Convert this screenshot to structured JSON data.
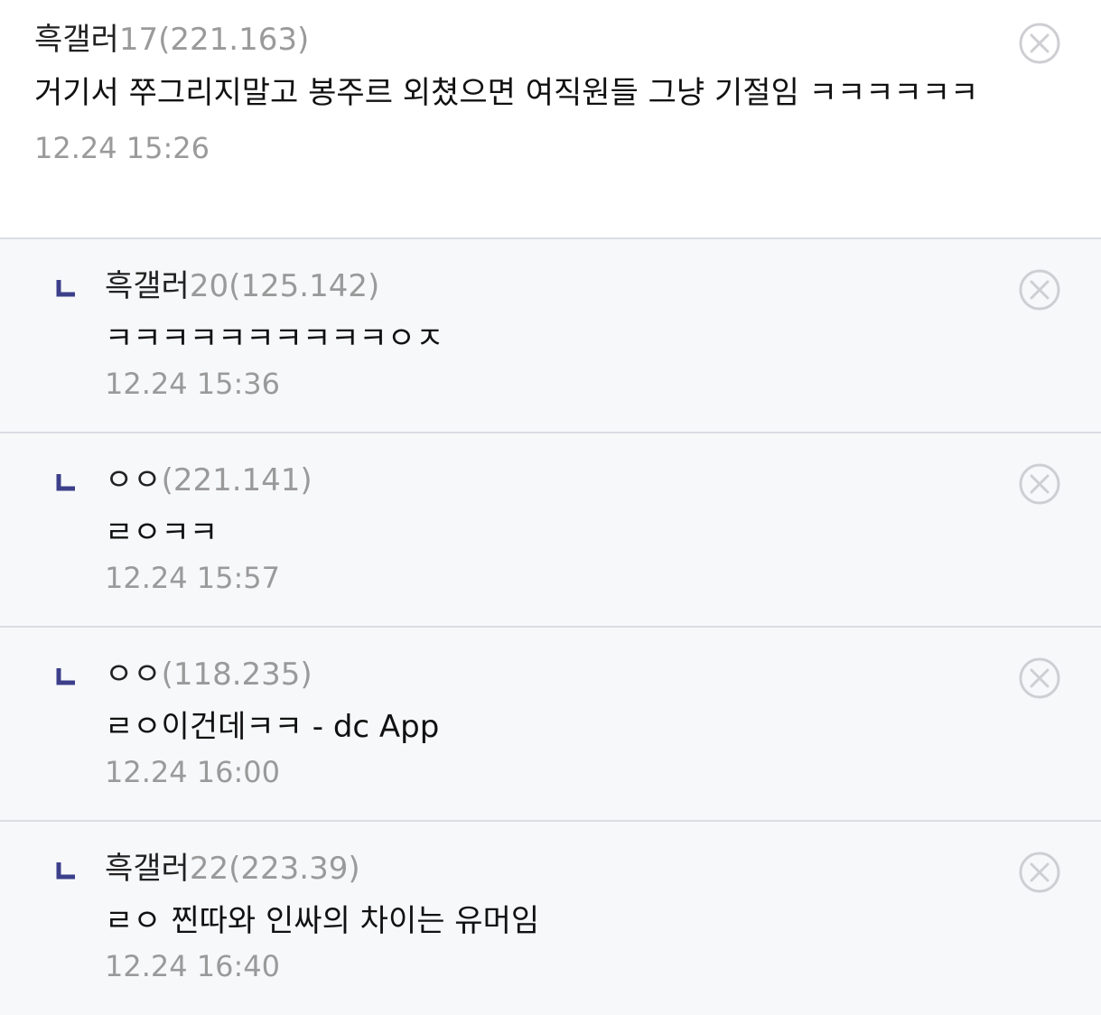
{
  "comments": [
    {
      "nick": "흑갤러",
      "nick_num": "17",
      "ip": "(221.163)",
      "text": "거기서 쭈그리지말고 봉주르 외쳤으면 여직원들 그냥 기절임 ㅋㅋㅋㅋㅋㅋ",
      "time": "12.24 15:26"
    },
    {
      "nick": "흑갤러",
      "nick_num": "20",
      "ip": "(125.142)",
      "text": "ㅋㅋㅋㅋㅋㅋㅋㅋㅋㅋㅇㅈ",
      "time": "12.24 15:36"
    },
    {
      "nick": "ㅇㅇ",
      "nick_num": "",
      "ip": "(221.141)",
      "text": "ㄹㅇㅋㅋ",
      "time": "12.24 15:57"
    },
    {
      "nick": "ㅇㅇ",
      "nick_num": "",
      "ip": "(118.235)",
      "text": "ㄹㅇ이건데ㅋㅋ - dc App",
      "time": "12.24 16:00"
    },
    {
      "nick": "흑갤러",
      "nick_num": "22",
      "ip": "(223.39)",
      "text": "ㄹㅇ 찐따와 인싸의 차이는 유머임",
      "time": "12.24 16:40"
    }
  ],
  "colors": {
    "reply_mark": "#3c3f8a",
    "delete_icon": "#cfcfd3",
    "meta_gray": "#9a9a9a",
    "reply_bg": "#f7f8fa",
    "divider": "#dcdde3"
  },
  "icons": {
    "reply": "reply-arrow-icon",
    "delete": "close-circle-icon"
  }
}
